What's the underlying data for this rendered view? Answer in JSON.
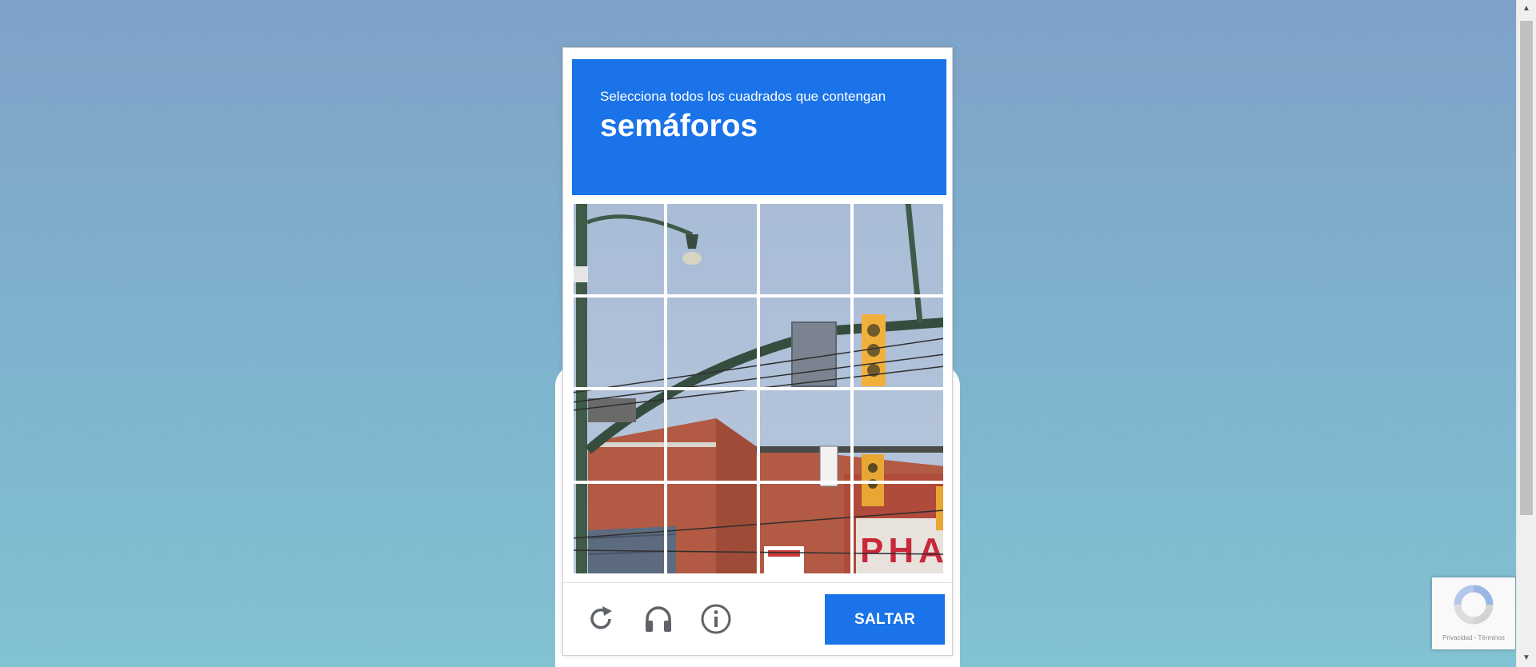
{
  "captcha": {
    "instruction": "Selecciona todos los cuadrados que contengan",
    "object": "semáforos",
    "grid": {
      "rows": 4,
      "columns": 4
    },
    "skip_label": "SALTAR",
    "icons": [
      "reload-icon",
      "audio-headphones-icon",
      "info-icon"
    ],
    "colors": {
      "accent": "#1a73e8",
      "header_text": "#ffffff"
    }
  },
  "scene": {
    "sign_text": "PHAR"
  },
  "badge": {
    "text": "Privacidad - Términos"
  }
}
